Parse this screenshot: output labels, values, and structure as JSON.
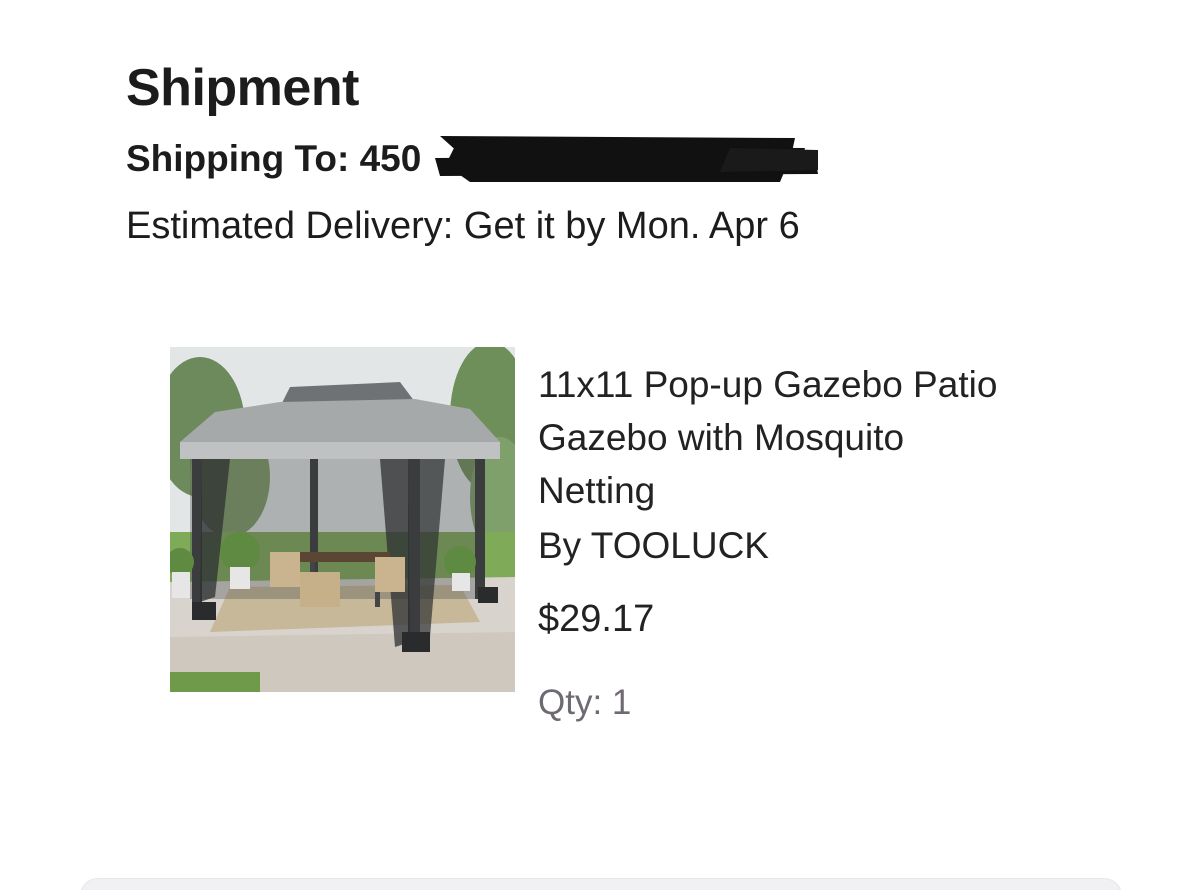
{
  "shipment": {
    "title": "Shipment",
    "shipping_to_label": "Shipping To:",
    "shipping_to_value": "450",
    "estimated_delivery": "Estimated Delivery: Get it by Mon. Apr 6"
  },
  "item": {
    "image_icon": "gazebo-photo",
    "title": "11x11 Pop-up Gazebo Patio Gazebo with Mosquito Netting",
    "seller": "By TOOLUCK",
    "price": "$29.17",
    "qty_label": "Qty:",
    "qty_value": "1"
  },
  "colors": {
    "text": "#1c1c1c",
    "muted": "#6f6a72",
    "redaction": "#111111"
  }
}
